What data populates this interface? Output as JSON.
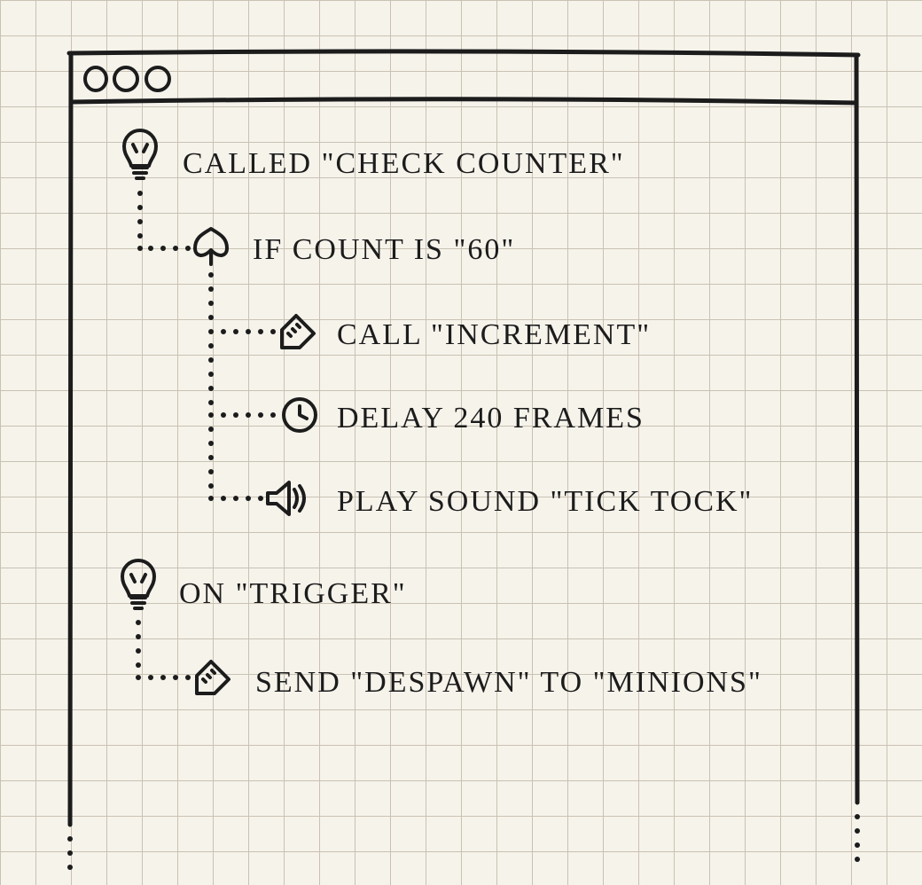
{
  "tree": {
    "nodes": {
      "n1": {
        "label": "CALLED \"CHECK COUNTER\""
      },
      "n2": {
        "label": "IF COUNT IS \"60\""
      },
      "n3": {
        "label": "CALL \"INCREMENT\""
      },
      "n4": {
        "label": "DELAY 240 FRAMES"
      },
      "n5": {
        "label": "PLAY SOUND \"TICK TOCK\""
      },
      "n6": {
        "label": "ON \"TRIGGER\""
      },
      "n7": {
        "label": "SEND \"DESPAWN\" TO \"MINIONS\""
      }
    }
  }
}
